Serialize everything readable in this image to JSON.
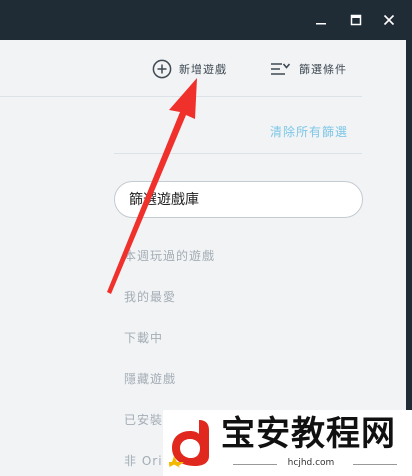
{
  "toolbar": {
    "add_game_label": "新增遊戲",
    "filter_label": "篩選條件"
  },
  "filters": {
    "clear_all_label": "清除所有篩選",
    "search_placeholder": "篩選遊戲庫",
    "items": [
      "本週玩過的遊戲",
      "我的最愛",
      "下載中",
      "隱藏遊戲",
      "已安裝",
      "非 Ori"
    ]
  },
  "watermark": {
    "brand": "宝安教程网",
    "url": "hcjhd.com"
  },
  "colors": {
    "titlebar": "#1f2b35",
    "link": "#7cc6e6",
    "arrow": "#f0302a",
    "logo_red": "#e0281f",
    "logo_yellow": "#f5b800"
  }
}
